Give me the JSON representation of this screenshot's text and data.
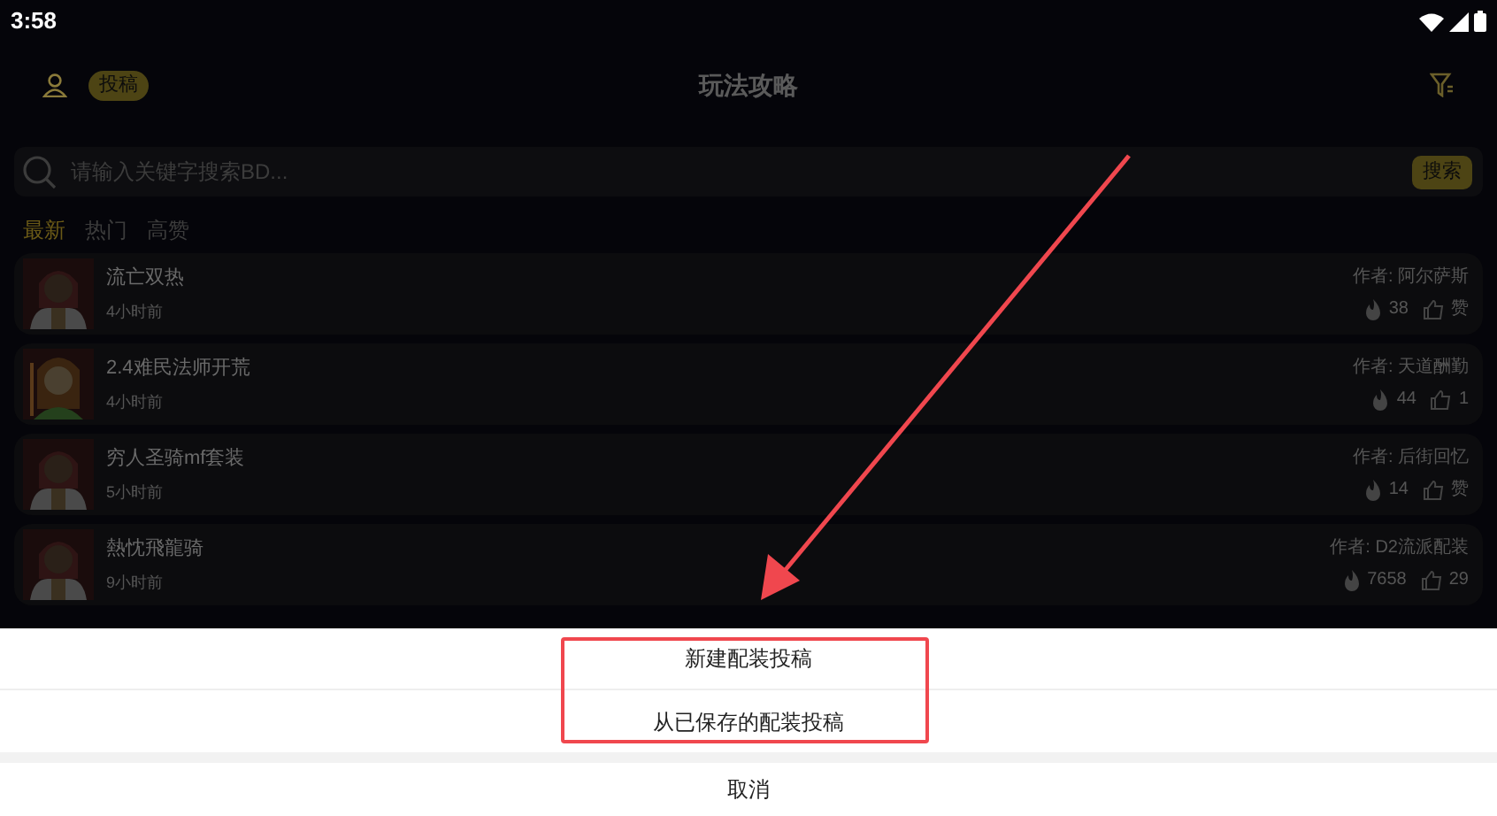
{
  "status_bar": {
    "time": "3:58"
  },
  "header": {
    "post_badge": "投稿",
    "title": "玩法攻略"
  },
  "search": {
    "placeholder": "请输入关键字搜索BD...",
    "button": "搜索"
  },
  "tabs": [
    {
      "label": "最新",
      "selected": true
    },
    {
      "label": "热门",
      "selected": false
    },
    {
      "label": "高赞",
      "selected": false
    }
  ],
  "posts": [
    {
      "title": "流亡双热",
      "time": "4小时前",
      "author": "作者: 阿尔萨斯",
      "views": "38",
      "likes": "赞"
    },
    {
      "title": "2.4难民法师开荒",
      "time": "4小时前",
      "author": "作者: 天道酬勤",
      "views": "44",
      "likes": "1"
    },
    {
      "title": "穷人圣骑mf套装",
      "time": "5小时前",
      "author": "作者: 后街回忆",
      "views": "14",
      "likes": "赞"
    },
    {
      "title": "熱忱飛龍骑",
      "time": "9小时前",
      "author": "作者: D2流派配装",
      "views": "7658",
      "likes": "29"
    }
  ],
  "action_sheet": {
    "options": [
      "新建配装投稿",
      "从已保存的配装投稿"
    ],
    "cancel": "取消"
  },
  "annotation": {
    "highlight": true,
    "arrow": true
  }
}
